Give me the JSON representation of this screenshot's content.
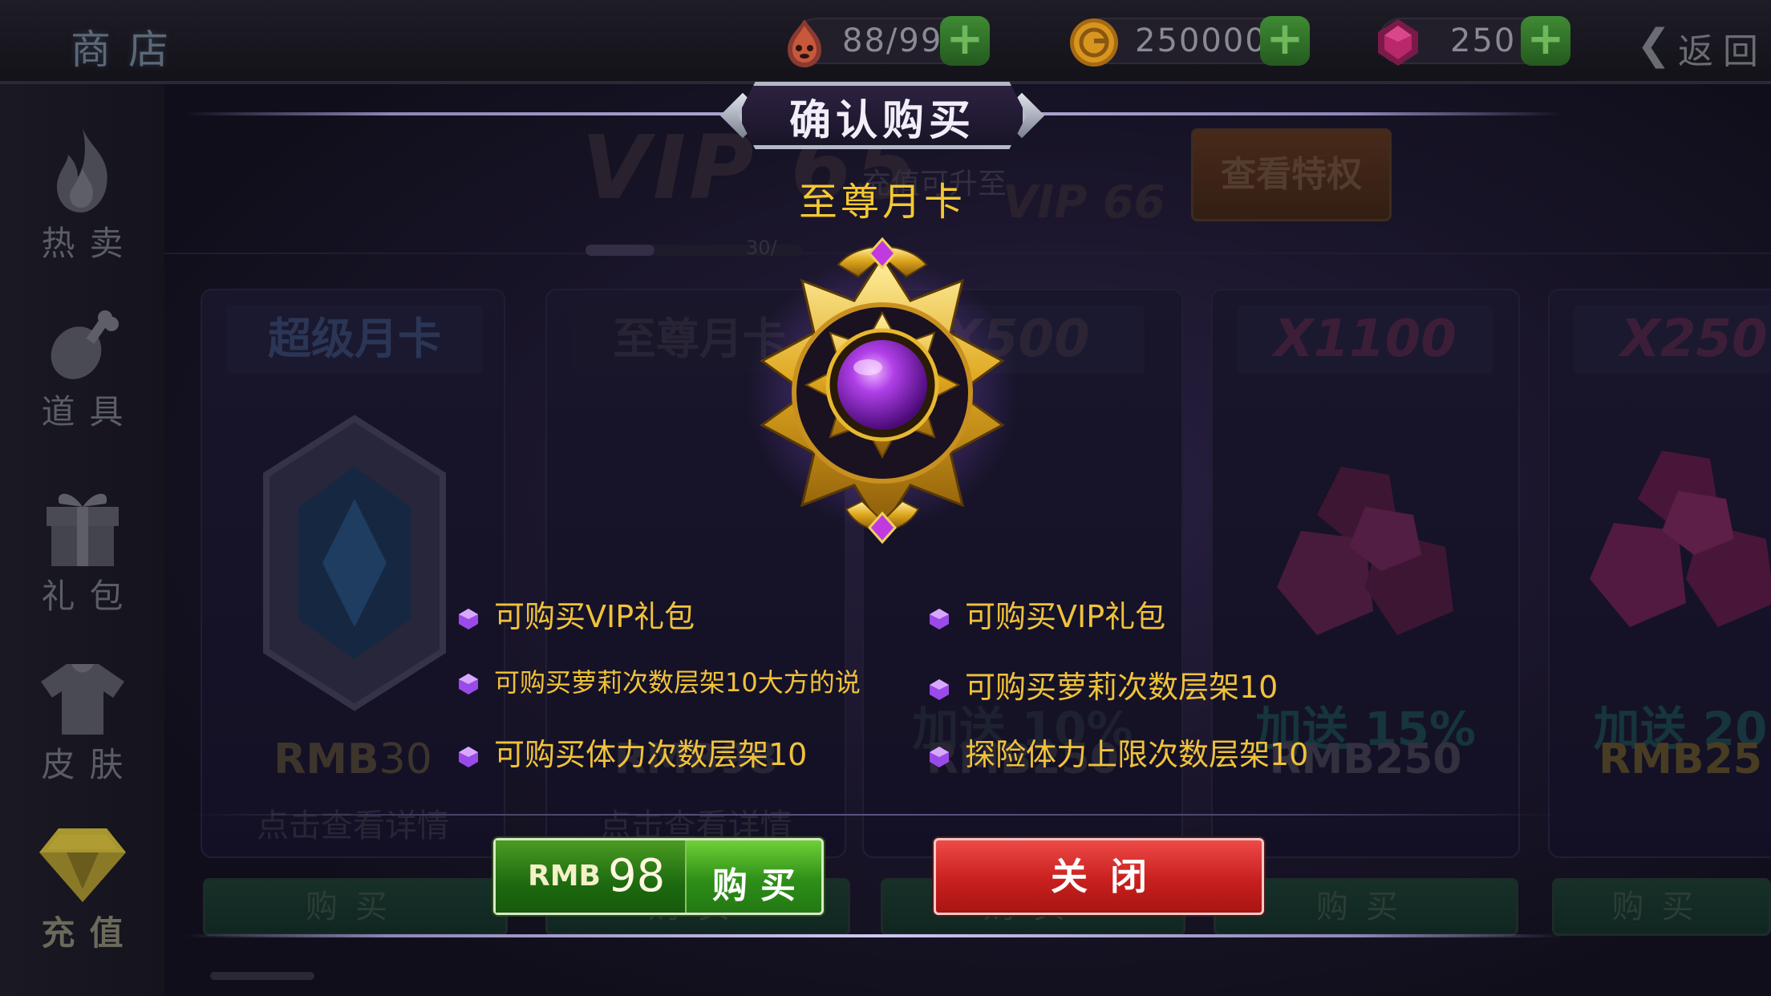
{
  "topbar": {
    "title": "商店",
    "stamina": "88/99",
    "gold": "250000",
    "gems": "250",
    "back_label": "返回"
  },
  "sidebar": {
    "items": [
      {
        "label": "热卖",
        "icon": "flame-icon"
      },
      {
        "label": "道具",
        "icon": "drumstick-icon"
      },
      {
        "label": "礼包",
        "icon": "gift-icon"
      },
      {
        "label": "皮肤",
        "icon": "shirt-icon"
      },
      {
        "label": "充值",
        "icon": "diamond-icon",
        "active": true
      }
    ]
  },
  "store": {
    "vip_level": "VIP 65",
    "vip_next": "VIP 66",
    "vip_hint": "充值可升至",
    "vip_progress_text": "30/",
    "vip_progress": 0.32,
    "view_privileges": "查看特权",
    "cards": [
      {
        "title": "超级月卡",
        "price_cur": "RMB",
        "price_num": "30",
        "detail": "点击查看详情"
      },
      {
        "title": "至尊月卡",
        "price_cur": "RMB",
        "price_num": "98",
        "detail": "点击查看详情"
      },
      {
        "title": "X500",
        "bonus": "加送 10%",
        "price_cur": "RMB",
        "price_num": "250"
      },
      {
        "title": "X1100",
        "bonus": "加送 15%",
        "price_cur": "RMB",
        "price_num": "250"
      },
      {
        "title": "X250",
        "bonus": "加送 20",
        "price_cur": "RMB",
        "price_num": "25"
      }
    ],
    "buy_label": "购买"
  },
  "dialog": {
    "title": "确认购买",
    "card_name": "至尊月卡",
    "features_left": [
      "可购买VIP礼包",
      "可购买萝莉次数层架10大方的说",
      "可购买体力次数层架10"
    ],
    "features_right": [
      "可购买VIP礼包",
      "可购买萝莉次数层架10",
      "探险体力上限次数层架10"
    ],
    "buy_currency": "RMB",
    "buy_amount": "98",
    "buy_label": "购买",
    "close_label": "关闭"
  },
  "colors": {
    "accent_gold": "#f0c23a",
    "buy_green": "#2e8f18",
    "close_red": "#c8201e",
    "gem_purple": "#a040d8"
  }
}
